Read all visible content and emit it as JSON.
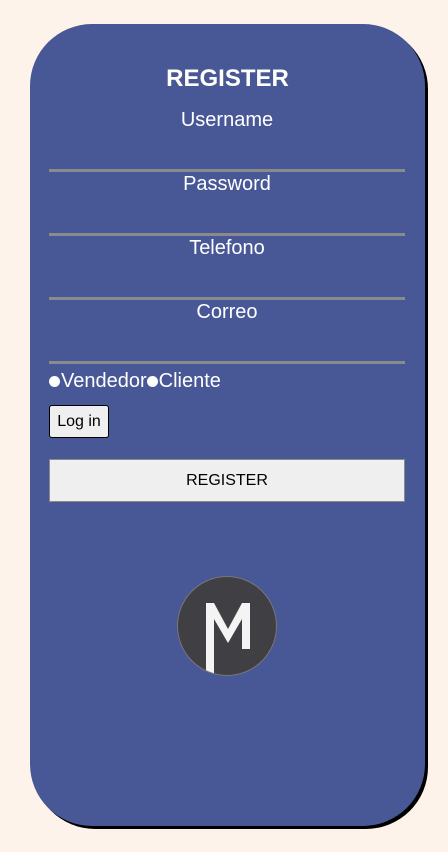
{
  "form": {
    "title": "REGISTER",
    "fields": [
      {
        "label": "Username"
      },
      {
        "label": "Password"
      },
      {
        "label": "Telefono"
      },
      {
        "label": "Correo"
      }
    ],
    "radio_options": [
      "Vendedor",
      "Cliente"
    ],
    "login_label": "Log in",
    "register_label": "REGISTER"
  },
  "icons": {
    "logo": "m-logo-icon",
    "radio": "radio-dot-icon"
  },
  "colors": {
    "page_background": "#fdf3ea",
    "card": "#485796",
    "divider": "#8a8a8a",
    "button": "#efefef",
    "logo_background": "#404044"
  }
}
